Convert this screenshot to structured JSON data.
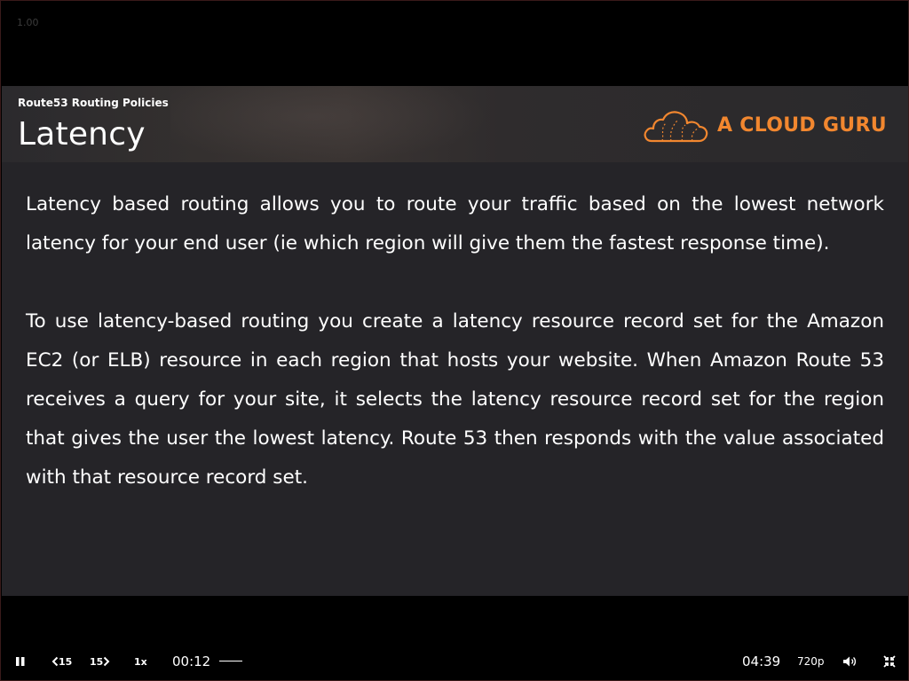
{
  "player": {
    "zoom_level": "1.00"
  },
  "slide": {
    "section_label": "Route53 Routing Policies",
    "title": "Latency",
    "logo_text": "A CLOUD GURU",
    "brand_color": "#f2872f",
    "paragraphs": [
      "Latency based routing allows you to route your traffic based on the lowest network latency for your end user (ie which region will give them the fastest response time).",
      "To use latency-based routing you create a latency resource record set for the Amazon EC2 (or ELB) resource in each region that hosts your website. When Amazon Route 53 receives a query for your site, it selects the latency resource record set for the region that gives the user the lowest latency. Route 53 then responds with the value associated with that resource record set."
    ]
  },
  "controls": {
    "play_pause_icon": "pause-icon",
    "rewind_label": "15",
    "rewind_icon": "chevron-left-icon",
    "forward_label": "15",
    "forward_icon": "chevron-right-icon",
    "speed_label": "1x",
    "current_time": "00:12",
    "duration": "04:39",
    "quality_label": "720p",
    "volume_icon": "volume-icon",
    "exit_fullscreen_icon": "exit-fullscreen-icon"
  }
}
